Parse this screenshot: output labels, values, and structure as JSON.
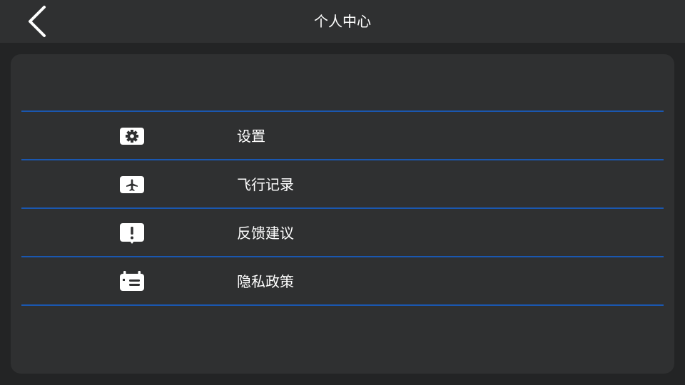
{
  "header": {
    "title": "个人中心",
    "back_icon": "chevron-left-icon"
  },
  "menu": {
    "items": [
      {
        "label": "设置",
        "icon": "gear-icon"
      },
      {
        "label": "飞行记录",
        "icon": "airplane-icon"
      },
      {
        "label": "反馈建议",
        "icon": "exclamation-icon"
      },
      {
        "label": "隐私政策",
        "icon": "calendar-note-icon"
      }
    ]
  },
  "colors": {
    "background": "#232425",
    "panel": "#2f3031",
    "divider": "#1a57b0",
    "text": "#ffffff"
  }
}
